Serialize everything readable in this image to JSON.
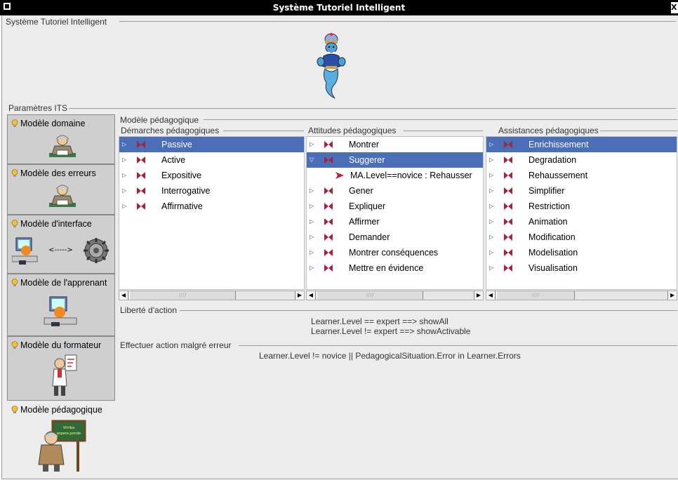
{
  "window": {
    "title": "Système Tutoriel Intelligent"
  },
  "top_group": {
    "label": "Système Tutoriel Intelligent"
  },
  "params": {
    "label": "Paramètres ITS"
  },
  "sidebar": {
    "items": [
      {
        "label": "Modèle domaine"
      },
      {
        "label": "Modèle des erreurs"
      },
      {
        "label": "Modèle d'interface",
        "arrow_text": "<----->"
      },
      {
        "label": "Modèle de l'apprenant"
      },
      {
        "label": "Modèle du formateur"
      },
      {
        "label": "Modèle pédagogique",
        "board_text": "Vitriba espere ponde"
      }
    ]
  },
  "panel": {
    "title": "Modèle pédagogique",
    "lists": [
      {
        "label": "Démarches pédagogiques",
        "items": [
          "Passive",
          "Active",
          "Expositive",
          "Interrogative",
          "Affirmative"
        ],
        "selected": 0
      },
      {
        "label": "Attitudes pédagogiques",
        "items": [
          "Montrer",
          "Suggerer",
          "Gener",
          "Expliquer",
          "Affirmer",
          "Demander",
          "Montrer conséquences",
          "Mettre en évidence"
        ],
        "selected": 1,
        "expanded_child": "MA.Level==novice  : Rehausser"
      },
      {
        "label": "Assistances pédagogiques",
        "items": [
          "Enrichissement",
          "Degradation",
          "Rehaussement",
          "Simplifier",
          "Restriction",
          "Animation",
          "Modification",
          "Modelisation",
          "Visualisation"
        ],
        "selected": 0
      }
    ],
    "liberte": {
      "label": "Liberté d'action",
      "line1": "Learner.Level == expert ==> showAll",
      "line2": "Learner.Level != expert  ==> showActivable"
    },
    "effectuer": {
      "label": "Effectuer action malgré erreur",
      "rule": "Learner.Level != novice ||  PedagogicalSituation.Error in Learner.Errors"
    }
  }
}
